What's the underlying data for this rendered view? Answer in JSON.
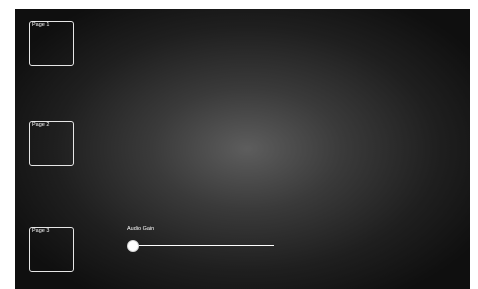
{
  "pages": [
    {
      "label": "Page 1"
    },
    {
      "label": "Page 2"
    },
    {
      "label": "Page 3"
    }
  ],
  "audio_gain": {
    "label": "Audio Gain",
    "value_fraction": 0.0
  },
  "colors": {
    "background_center": "#5d5d5d",
    "background_edge": "#0f0f0f",
    "foreground": "#ffffff"
  }
}
